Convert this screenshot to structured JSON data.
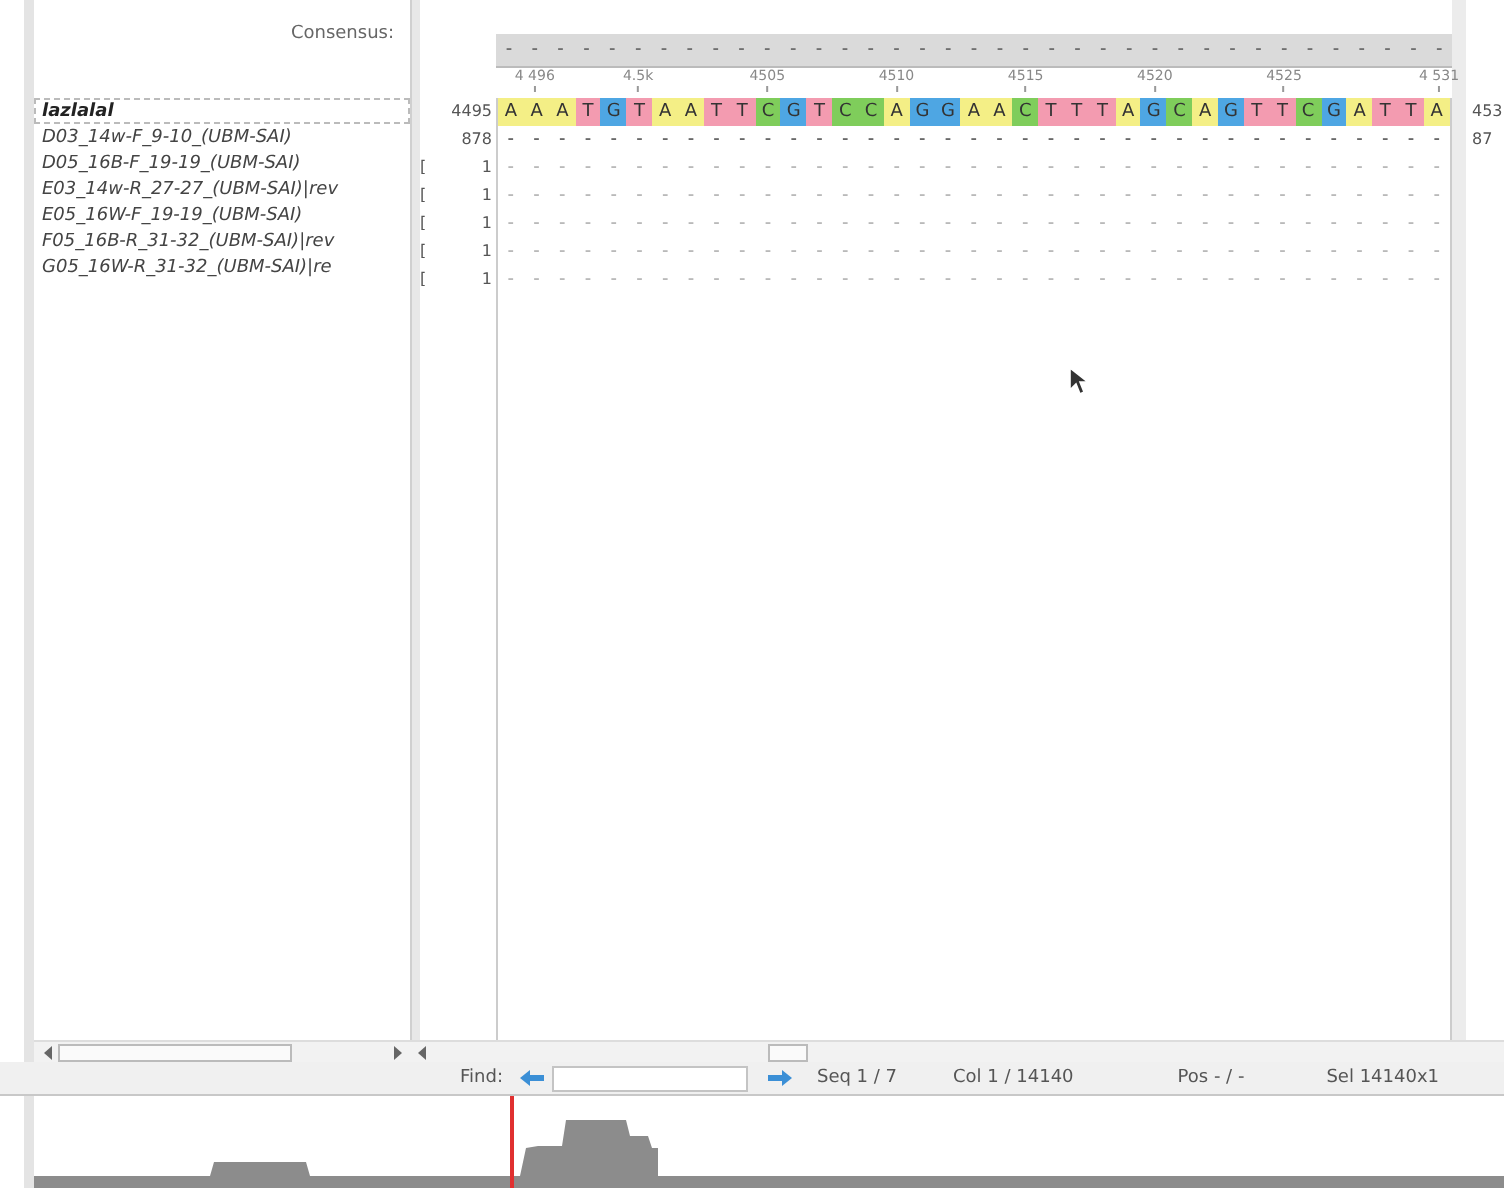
{
  "consensus": {
    "label": "Consensus:",
    "sequence": [
      "-",
      "-",
      "-",
      "-",
      "-",
      "-",
      "-",
      "-",
      "-",
      "-",
      "-",
      "-",
      "-",
      "-",
      "-",
      "-",
      "-",
      "-",
      "-",
      "-",
      "-",
      "-",
      "-",
      "-",
      "-",
      "-",
      "-",
      "-",
      "-",
      "-",
      "-",
      "-",
      "-",
      "-",
      "-",
      "-",
      "-"
    ]
  },
  "ruler": [
    {
      "label": "4 496"
    },
    {
      "label": "4.5k"
    },
    {
      "label": "4505"
    },
    {
      "label": "4510"
    },
    {
      "label": "4515"
    },
    {
      "label": "4520"
    },
    {
      "label": "4525"
    },
    {
      "label": "4 531"
    }
  ],
  "rows": [
    {
      "kind": "reference",
      "name": "lazlalal",
      "selected": true,
      "start": "4495",
      "end": "453",
      "sequence": [
        "A",
        "A",
        "A",
        "T",
        "G",
        "T",
        "A",
        "A",
        "T",
        "T",
        "C",
        "G",
        "T",
        "C",
        "C",
        "A",
        "G",
        "G",
        "A",
        "A",
        "C",
        "T",
        "T",
        "T",
        "A",
        "G",
        "C",
        "A",
        "G",
        "T",
        "T",
        "C",
        "G",
        "A",
        "T",
        "T",
        "A"
      ]
    },
    {
      "kind": "read",
      "name": "D03_14w-F_9-10_(UBM-SAI)",
      "selected": false,
      "dim": false,
      "start": "878",
      "end": "87",
      "sequence": [
        "-",
        "-",
        "-",
        "-",
        "-",
        "-",
        "-",
        "-",
        "-",
        "-",
        "-",
        "-",
        "-",
        "-",
        "-",
        "-",
        "-",
        "-",
        "-",
        "-",
        "-",
        "-",
        "-",
        "-",
        "-",
        "-",
        "-",
        "-",
        "-",
        "-",
        "-",
        "-",
        "-",
        "-",
        "-",
        "-",
        "-"
      ]
    },
    {
      "kind": "read",
      "name": "D05_16B-F_19-19_(UBM-SAI)",
      "selected": false,
      "dim": true,
      "bracket": "[",
      "start": "1",
      "sequence": [
        "-",
        "-",
        "-",
        "-",
        "-",
        "-",
        "-",
        "-",
        "-",
        "-",
        "-",
        "-",
        "-",
        "-",
        "-",
        "-",
        "-",
        "-",
        "-",
        "-",
        "-",
        "-",
        "-",
        "-",
        "-",
        "-",
        "-",
        "-",
        "-",
        "-",
        "-",
        "-",
        "-",
        "-",
        "-",
        "-",
        "-"
      ]
    },
    {
      "kind": "read",
      "name": "E03_14w-R_27-27_(UBM-SAI)|rev",
      "selected": false,
      "dim": true,
      "bracket": "[",
      "start": "1",
      "sequence": [
        "-",
        "-",
        "-",
        "-",
        "-",
        "-",
        "-",
        "-",
        "-",
        "-",
        "-",
        "-",
        "-",
        "-",
        "-",
        "-",
        "-",
        "-",
        "-",
        "-",
        "-",
        "-",
        "-",
        "-",
        "-",
        "-",
        "-",
        "-",
        "-",
        "-",
        "-",
        "-",
        "-",
        "-",
        "-",
        "-",
        "-"
      ]
    },
    {
      "kind": "read",
      "name": "E05_16W-F_19-19_(UBM-SAI)",
      "selected": false,
      "dim": true,
      "bracket": "[",
      "start": "1",
      "sequence": [
        "-",
        "-",
        "-",
        "-",
        "-",
        "-",
        "-",
        "-",
        "-",
        "-",
        "-",
        "-",
        "-",
        "-",
        "-",
        "-",
        "-",
        "-",
        "-",
        "-",
        "-",
        "-",
        "-",
        "-",
        "-",
        "-",
        "-",
        "-",
        "-",
        "-",
        "-",
        "-",
        "-",
        "-",
        "-",
        "-",
        "-"
      ]
    },
    {
      "kind": "read",
      "name": "F05_16B-R_31-32_(UBM-SAI)|rev",
      "selected": false,
      "dim": true,
      "bracket": "[",
      "start": "1",
      "sequence": [
        "-",
        "-",
        "-",
        "-",
        "-",
        "-",
        "-",
        "-",
        "-",
        "-",
        "-",
        "-",
        "-",
        "-",
        "-",
        "-",
        "-",
        "-",
        "-",
        "-",
        "-",
        "-",
        "-",
        "-",
        "-",
        "-",
        "-",
        "-",
        "-",
        "-",
        "-",
        "-",
        "-",
        "-",
        "-",
        "-",
        "-"
      ]
    },
    {
      "kind": "read",
      "name": "G05_16W-R_31-32_(UBM-SAI)|re",
      "selected": false,
      "dim": true,
      "bracket": "[",
      "start": "1",
      "sequence": [
        "-",
        "-",
        "-",
        "-",
        "-",
        "-",
        "-",
        "-",
        "-",
        "-",
        "-",
        "-",
        "-",
        "-",
        "-",
        "-",
        "-",
        "-",
        "-",
        "-",
        "-",
        "-",
        "-",
        "-",
        "-",
        "-",
        "-",
        "-",
        "-",
        "-",
        "-",
        "-",
        "-",
        "-",
        "-",
        "-",
        "-"
      ]
    }
  ],
  "find_bar": {
    "label": "Find:",
    "seq": "Seq 1 / 7",
    "col": "Col 1 / 14140",
    "pos": "Pos - / -",
    "sel": "Sel 14140x1"
  }
}
